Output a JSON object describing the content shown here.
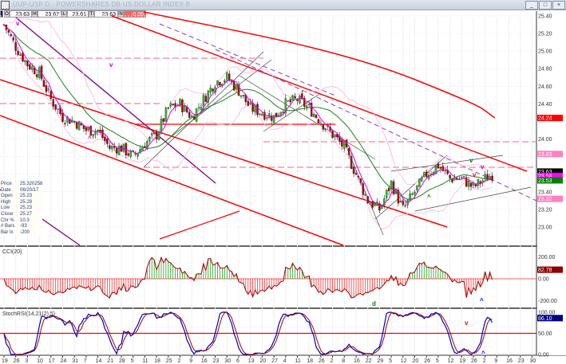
{
  "window": {
    "title": "UUP-USP D - POWERSHARES DB US DOLLAR INDEX B",
    "buttons": [
      "minimize",
      "maximize",
      "close"
    ]
  },
  "toolbar": {
    "open_label": "O",
    "open": "23.63",
    "high_label": "H",
    "high": "23.67",
    "low_label": "L",
    "low": "23.61",
    "last_label": "T",
    "last": "23.63",
    "net_label": "N",
    "net": "-0.09"
  },
  "info_box": {
    "rows": [
      {
        "k": "Price",
        "v": "25.320258"
      },
      {
        "k": "Date",
        "v": "06/20/17"
      },
      {
        "k": "Open",
        "v": "25.23"
      },
      {
        "k": "High",
        "v": "25.29"
      },
      {
        "k": "Low",
        "v": "25.23"
      },
      {
        "k": "Close",
        "v": "25.27"
      },
      {
        "k": "Chr %",
        "v": "10.3"
      },
      {
        "k": "# Bars",
        "v": "-93"
      },
      {
        "k": "Bar Ix",
        "v": "-200"
      }
    ]
  },
  "chart_data": [
    {
      "type": "candlestick",
      "title": "Price",
      "weekly_closes": [
        25.3,
        25.05,
        24.85,
        24.75,
        24.45,
        24.25,
        24.2,
        24.1,
        24.1,
        23.9,
        23.9,
        23.8,
        23.95,
        24.05,
        24.35,
        24.4,
        24.25,
        24.45,
        24.65,
        24.7,
        24.55,
        24.35,
        24.3,
        24.25,
        24.4,
        24.45,
        24.35,
        24.2,
        24.05,
        23.9,
        23.6,
        23.3,
        23.2,
        23.5,
        23.2,
        23.4,
        23.6,
        23.7,
        23.55,
        23.55,
        23.45,
        23.55,
        23.63
      ],
      "ylim": [
        22.9,
        25.45
      ],
      "yticks": [
        "25.40",
        "25.20",
        "25.00",
        "24.80",
        "24.60",
        "24.40",
        "24.00",
        "23.40",
        "23.20",
        "23.00"
      ],
      "ytick_values": [
        25.4,
        25.2,
        25.0,
        24.8,
        24.6,
        24.4,
        24.0,
        23.4,
        23.2,
        23.0
      ],
      "price_badges": [
        {
          "value": "24.24",
          "color": "#ff0000",
          "text_color": "#ffffff"
        },
        {
          "value": "23.83",
          "color": "#ff80c0",
          "text_color": "#ffffff"
        },
        {
          "value": "23.63",
          "color": "#000000",
          "text_color": "#ffffff"
        },
        {
          "value": "23.58",
          "color": "#ff00ff",
          "text_color": "#ffffff"
        },
        {
          "value": "23.53",
          "color": "#008000",
          "text_color": "#ffffff"
        },
        {
          "value": "23.32",
          "color": "#ff80c0",
          "text_color": "#ffffff"
        }
      ],
      "annotations": [
        {
          "text": "v",
          "color": "#cc00cc"
        },
        {
          "text": "v",
          "color": "#cc00cc"
        },
        {
          "text": "^",
          "color": "#cc00cc"
        },
        {
          "text": "^",
          "color": "#008000"
        },
        {
          "text": "v",
          "color": "#008000"
        },
        {
          "text": "v",
          "color": "#cc00cc"
        },
        {
          "text": "v",
          "color": "#ff0000"
        }
      ]
    },
    {
      "type": "histogram",
      "title": "CCI(20)",
      "ylim": [
        -250,
        250
      ],
      "yticks": [
        "200.00",
        "0.00",
        "-200.00"
      ],
      "ytick_values": [
        200,
        0,
        -200
      ],
      "last_value": "82.78",
      "last_color": "#8b0000",
      "annotations": [
        {
          "text": "d",
          "color": "#008000"
        },
        {
          "text": "^",
          "color": "#0000ff"
        }
      ]
    },
    {
      "type": "line",
      "title": "StochRSI(14,21(2),5)",
      "ylim": [
        0,
        100
      ],
      "yticks": [
        "100.00",
        "50.00",
        "0.00"
      ],
      "ytick_values": [
        100,
        50,
        0
      ],
      "last_value": "86.10",
      "last_color": "#000080",
      "annotations": [
        {
          "text": "v",
          "color": "#ff0000"
        },
        {
          "text": "^",
          "color": "#0000ff"
        }
      ]
    }
  ],
  "x_axis": {
    "labels": [
      "19",
      "26",
      "3",
      "10",
      "17",
      "24",
      "31",
      "7",
      "14",
      "21",
      "28",
      "5",
      "11",
      "18",
      "25",
      "2",
      "9",
      "16",
      "23",
      "30",
      "6",
      "13",
      "20",
      "27",
      "4",
      "11",
      "18",
      "26",
      "2",
      "8",
      "16",
      "22",
      "29",
      "5",
      "12",
      "20",
      "26",
      "5",
      "12",
      "19",
      "26",
      "2",
      "9",
      "16",
      "23",
      "30"
    ]
  }
}
